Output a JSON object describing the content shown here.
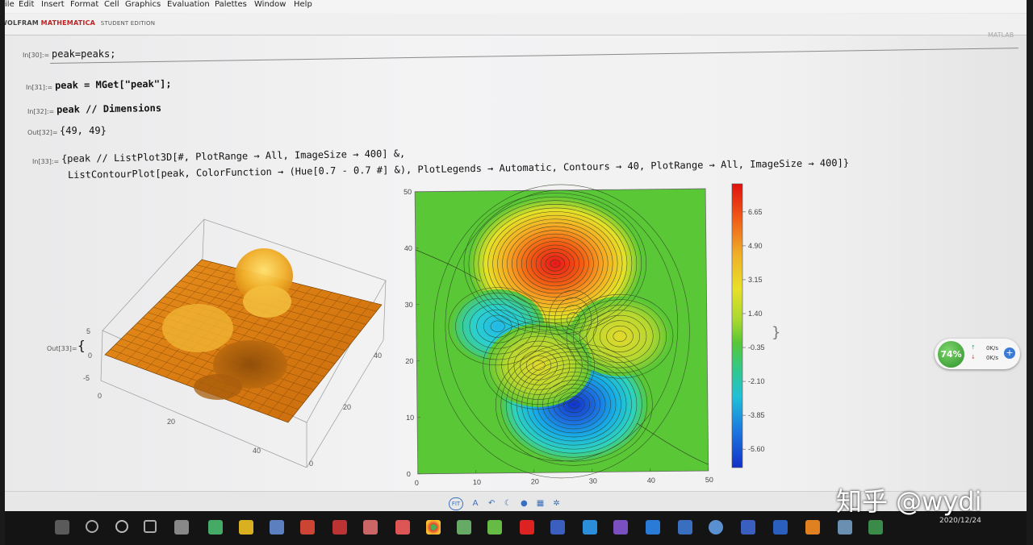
{
  "menu": [
    "File",
    "Edit",
    "Insert",
    "Format",
    "Cell",
    "Graphics",
    "Evaluation",
    "Palettes",
    "Window",
    "Help"
  ],
  "brand": {
    "wolfram": "WOLFRAM",
    "mathematica": "MATHEMATICA",
    "edition": "STUDENT EDITION",
    "right_label": "MATLAB"
  },
  "cells": [
    {
      "label": "In[30]:=",
      "code": "peak=peaks;"
    },
    {
      "label": "In[31]:=",
      "code": "peak = MGet[\"peak\"];"
    },
    {
      "label": "In[32]:=",
      "code": "peak // Dimensions"
    },
    {
      "label": "Out[32]=",
      "code": "{49, 49}"
    },
    {
      "label": "In[33]:=",
      "code": "{peak // ListPlot3D[#, PlotRange → All, ImageSize → 400] &,"
    },
    {
      "label": "",
      "code": "ListContourPlot[peak, ColorFunction → (Hue[0.7 - 0.7 #] &), PlotLegends → Automatic, Contours → 40, PlotRange → All, ImageSize → 400]}"
    },
    {
      "label": "Out[33]=",
      "code": "{"
    }
  ],
  "plot3d": {
    "z_ticks": [
      "5",
      "0",
      "-5"
    ],
    "x_ticks": [
      "0",
      "20",
      "40"
    ],
    "y_ticks": [
      "0",
      "20",
      "40"
    ],
    "surface_color": "#f0a020"
  },
  "contour": {
    "x_ticks": [
      "0",
      "10",
      "20",
      "30",
      "40",
      "50"
    ],
    "y_ticks": [
      "50",
      "40",
      "30",
      "20",
      "10",
      "0"
    ],
    "background_color": "#59c736",
    "legend_ticks": [
      "6.65",
      "4.90",
      "3.15",
      "1.40",
      "-0.35",
      "-2.10",
      "-3.85",
      "-5.60"
    ]
  },
  "chart_data": {
    "type": "heatmap",
    "title": "",
    "xlabel": "",
    "ylabel": "",
    "xlim": [
      0,
      50
    ],
    "ylim": [
      0,
      50
    ],
    "legend_range": [
      -6.55,
      8.1
    ],
    "legend_ticks": [
      6.65,
      4.9,
      3.15,
      1.4,
      -0.35,
      -2.1,
      -3.85,
      -5.6
    ],
    "features": [
      {
        "kind": "max",
        "x": 24,
        "y": 37,
        "value": 8.1
      },
      {
        "kind": "min",
        "x": 27,
        "y": 12,
        "value": -6.55
      },
      {
        "kind": "min",
        "x": 14,
        "y": 26,
        "value": -3.0
      },
      {
        "kind": "max",
        "x": 35,
        "y": 24,
        "value": 3.5
      },
      {
        "kind": "max",
        "x": 21,
        "y": 19,
        "value": 3.8
      },
      {
        "kind": "saddle",
        "x": 27,
        "y": 27,
        "value": -0.3
      }
    ],
    "contours": 40
  },
  "net": {
    "cpu": "74%",
    "up": "0K/s",
    "down": "0K/s"
  },
  "clock": {
    "date": "2020/12/24"
  },
  "watermark": "知乎 @wydi"
}
